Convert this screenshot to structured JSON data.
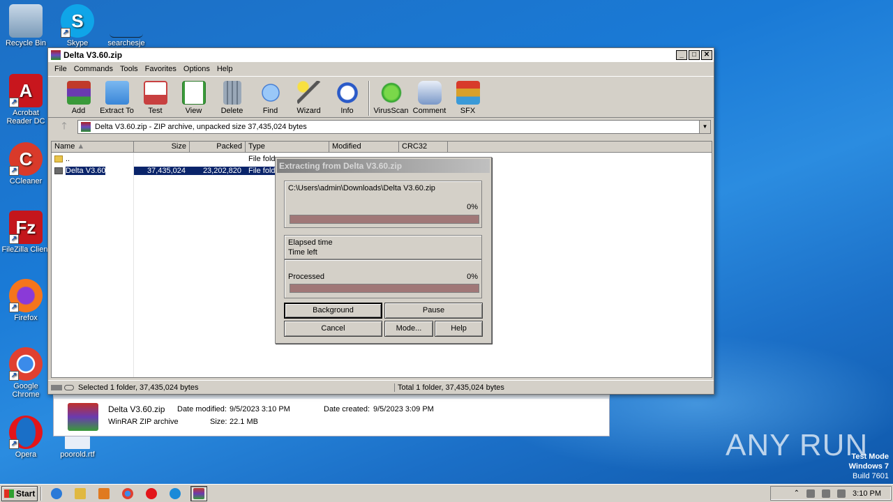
{
  "desktop": {
    "icons": [
      {
        "label": "Recycle Bin",
        "icon": "recycle-bin-icon",
        "color": "#7a9ab8"
      },
      {
        "label": "Skype",
        "icon": "skype-icon",
        "color": "#0fa5e8"
      },
      {
        "label": "searchesje",
        "icon": "blank-shortcut-icon",
        "color": "#1a5fb8"
      },
      {
        "label": "Acrobat Reader DC",
        "icon": "acrobat-icon",
        "color": "#c8161d"
      },
      {
        "label": "CCleaner",
        "icon": "ccleaner-icon",
        "color": "#d93a2a"
      },
      {
        "label": "FileZilla Client",
        "icon": "filezilla-icon",
        "color": "#c4161c"
      },
      {
        "label": "Firefox",
        "icon": "firefox-icon",
        "color": "#f5751b"
      },
      {
        "label": "Google Chrome",
        "icon": "chrome-icon",
        "color": "#3b8bea"
      },
      {
        "label": "Opera",
        "icon": "opera-icon",
        "color": "#e3151a"
      },
      {
        "label": "poorold.rtf",
        "icon": "document-icon",
        "color": "#e8eef8"
      }
    ]
  },
  "window": {
    "title": "Delta V3.60.zip",
    "menu": [
      "File",
      "Commands",
      "Tools",
      "Favorites",
      "Options",
      "Help"
    ],
    "toolbar": [
      {
        "label": "Add",
        "icon": "add-archive-icon",
        "color": "#b03a2a"
      },
      {
        "label": "Extract To",
        "icon": "extract-folder-icon",
        "color": "#3a86d8"
      },
      {
        "label": "Test",
        "icon": "test-clipboard-icon",
        "color": "#c84040"
      },
      {
        "label": "View",
        "icon": "view-book-icon",
        "color": "#3a9a3a"
      },
      {
        "label": "Delete",
        "icon": "trash-icon",
        "color": "#7a8a9a"
      },
      {
        "label": "Find",
        "icon": "magnifier-icon",
        "color": "#2a6ad0"
      },
      {
        "label": "Wizard",
        "icon": "wand-icon",
        "color": "#d8c040"
      },
      {
        "label": "Info",
        "icon": "info-icon",
        "color": "#2a5ac8"
      },
      {
        "label": "VirusScan",
        "icon": "virus-scan-icon",
        "color": "#2aa02a"
      },
      {
        "label": "Comment",
        "icon": "comment-icon",
        "color": "#7a98c8"
      },
      {
        "label": "SFX",
        "icon": "sfx-icon",
        "color": "#d86a2a"
      }
    ],
    "address": "Delta V3.60.zip - ZIP archive, unpacked size 37,435,024 bytes",
    "columns": [
      "Name",
      "Size",
      "Packed",
      "Type",
      "Modified",
      "CRC32"
    ],
    "rows": [
      {
        "name": "..",
        "size": "",
        "packed": "",
        "type": "File fold"
      },
      {
        "name": "Delta V3.60",
        "size": "37,435,024",
        "packed": "23,202,820",
        "type": "File fold"
      }
    ],
    "status_left": "Selected 1 folder, 37,435,024 bytes",
    "status_right": "Total 1 folder, 37,435,024 bytes"
  },
  "dialog": {
    "title": "Extracting from Delta V3.60.zip",
    "path": "C:\\Users\\admin\\Downloads\\Delta V3.60.zip",
    "file_percent_label": "0%",
    "file_progress": 0,
    "elapsed_label": "Elapsed time",
    "timeleft_label": "Time left",
    "processed_label": "Processed",
    "processed_percent_label": "0%",
    "processed_progress": 0,
    "buttons": {
      "background": "Background",
      "pause": "Pause",
      "cancel": "Cancel",
      "mode": "Mode...",
      "help": "Help"
    }
  },
  "detail_pane": {
    "filename": "Delta V3.60.zip",
    "filetype": "WinRAR ZIP archive",
    "modified_label": "Date modified:",
    "modified_value": "9/5/2023 3:10 PM",
    "size_label": "Size:",
    "size_value": "22.1 MB",
    "created_label": "Date created:",
    "created_value": "9/5/2023 3:09 PM"
  },
  "taskbar": {
    "start_label": "Start",
    "apps": [
      {
        "icon": "ie-icon",
        "color": "#2a7ad8"
      },
      {
        "icon": "explorer-icon",
        "color": "#e0b840"
      },
      {
        "icon": "media-player-icon",
        "color": "#e07a20"
      },
      {
        "icon": "chrome-icon",
        "color": "#3b8bea"
      },
      {
        "icon": "opera-icon",
        "color": "#e3151a"
      },
      {
        "icon": "edge-icon",
        "color": "#1a8ad8"
      },
      {
        "icon": "winrar-icon",
        "color": "#8a3ab0"
      }
    ],
    "clock": "3:10 PM"
  },
  "watermark": "ANY RUN",
  "test_mode": {
    "line1": "Test Mode",
    "line2": "Windows 7",
    "line3": "Build 7601"
  }
}
